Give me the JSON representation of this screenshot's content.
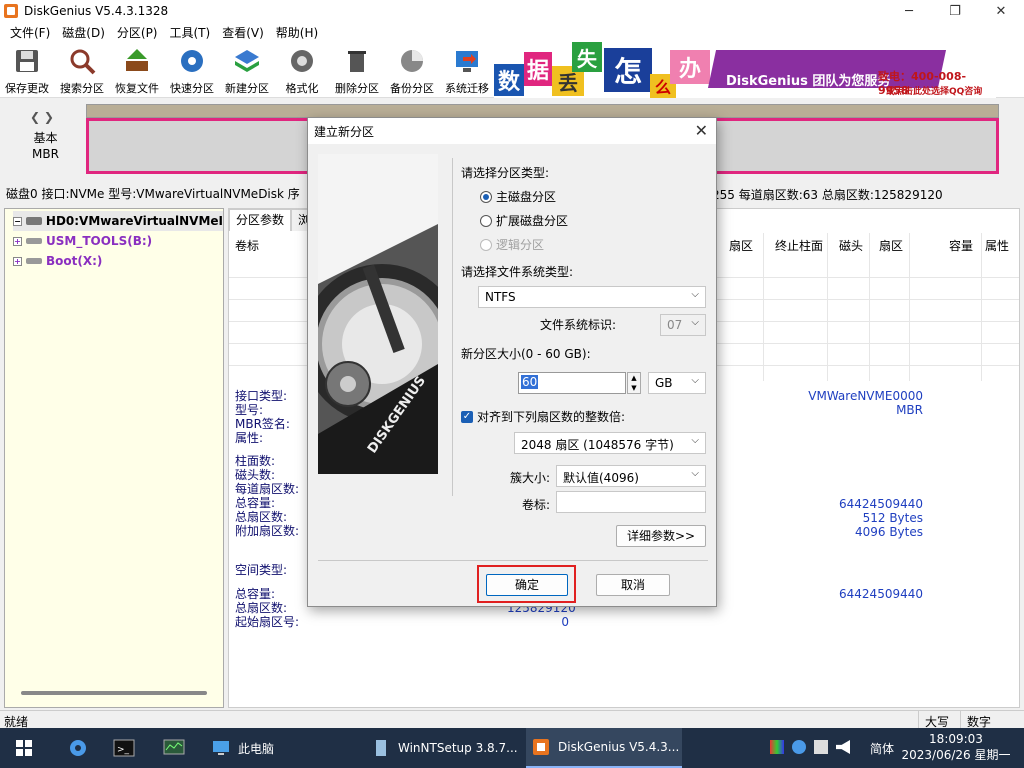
{
  "window": {
    "title": "DiskGenius V5.4.3.1328",
    "controls": [
      "─",
      "❐",
      "✕"
    ]
  },
  "menu": [
    "文件(F)",
    "磁盘(D)",
    "分区(P)",
    "工具(T)",
    "查看(V)",
    "帮助(H)"
  ],
  "toolbar": [
    {
      "label": "保存更改",
      "icon": "save-icon"
    },
    {
      "label": "搜索分区",
      "icon": "search-icon"
    },
    {
      "label": "恢复文件",
      "icon": "restore-icon"
    },
    {
      "label": "快速分区",
      "icon": "quick-partition-icon"
    },
    {
      "label": "新建分区",
      "icon": "new-partition-icon"
    },
    {
      "label": "格式化",
      "icon": "format-icon"
    },
    {
      "label": "删除分区",
      "icon": "delete-partition-icon"
    },
    {
      "label": "备份分区",
      "icon": "backup-icon"
    },
    {
      "label": "系统迁移",
      "icon": "migrate-icon"
    }
  ],
  "banner": {
    "chars": [
      "数",
      "据",
      "丢",
      "失",
      "怎",
      "么",
      "办"
    ],
    "slogan": "DiskGenius 团队为您服务",
    "phone": "致电：400-008-9958",
    "qq": "或点击此处选择QQ咨询"
  },
  "diskmap": {
    "type_line1": "基本",
    "type_line2": "MBR"
  },
  "diskinfo": {
    "left": "磁盘0 接口:NVMe  型号:VMwareVirtualNVMeDisk  序",
    "right": "255  每道扇区数:63  总扇区数:125829120"
  },
  "tree": {
    "disk": "HD0:VMwareVirtualNVMeI",
    "partitions": [
      "USM_TOOLS(B:)",
      "Boot(X:)"
    ]
  },
  "rightpane": {
    "tabs": [
      "分区参数",
      "浏"
    ],
    "columns": [
      "卷标",
      "扇区",
      "终止柱面",
      "磁头",
      "扇区",
      "容量",
      "属性"
    ],
    "labels_group1": [
      "接口类型:",
      "型号:",
      "MBR签名:",
      "属性:"
    ],
    "labels_group2": [
      "柱面数:",
      "磁头数:",
      "每道扇区数:",
      "总容量:",
      "总扇区数:",
      "附加扇区数:"
    ],
    "labels_group3": [
      "空间类型:"
    ],
    "labels_group4": [
      "总容量:",
      "总扇区数:",
      "起始扇区号:"
    ],
    "values_group1": [
      "VMWareNVME0000",
      "MBR"
    ],
    "values_group2": [
      "64424509440",
      "512 Bytes",
      "4096 Bytes"
    ],
    "values_group4": [
      "64424509440",
      "125829120",
      "0"
    ]
  },
  "status": {
    "text": "就绪",
    "caps": "大写",
    "num": "数字"
  },
  "taskbar": {
    "apps": [
      {
        "label": "此电脑"
      },
      {
        "label": "WinNTSetup 3.8.7..."
      },
      {
        "label": "DiskGenius V5.4.3..."
      }
    ],
    "lang": "简体",
    "time": "18:09:03",
    "date": "2023/06/26 星期一"
  },
  "dialog": {
    "title": "建立新分区",
    "partition_type_label": "请选择分区类型:",
    "partition_types": [
      "主磁盘分区",
      "扩展磁盘分区",
      "逻辑分区"
    ],
    "fs_type_label": "请选择文件系统类型:",
    "fs_type": "NTFS",
    "fs_id_label": "文件系统标识:",
    "fs_id": "07",
    "size_label": "新分区大小(0 - 60 GB):",
    "size_value": "60",
    "size_unit": "GB",
    "align_label": "对齐到下列扇区数的整数倍:",
    "align_value": "2048 扇区 (1048576 字节)",
    "cluster_label": "簇大小:",
    "cluster_value": "默认值(4096)",
    "volume_label": "卷标:",
    "volume_value": "",
    "advanced_button": "详细参数>>",
    "ok_button": "确定",
    "cancel_button": "取消",
    "hdd_brand": "DISKGENIUS"
  }
}
